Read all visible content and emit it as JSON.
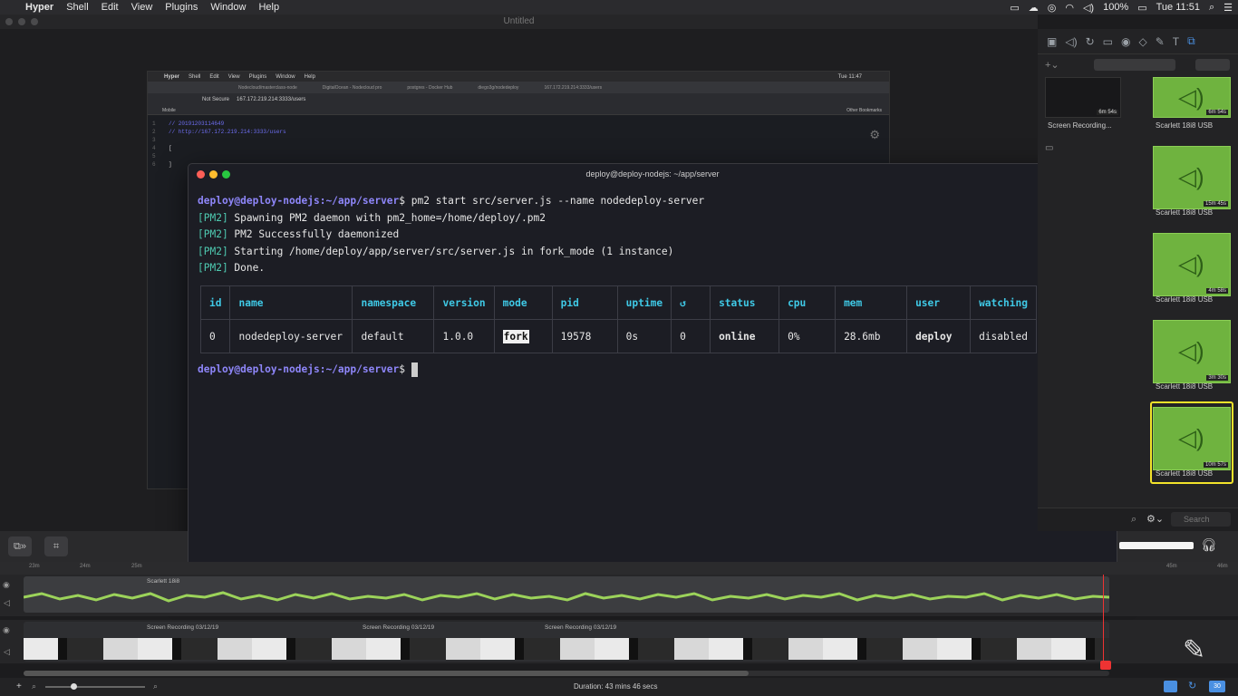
{
  "menubar": {
    "apple": "",
    "items": [
      "Hyper",
      "Shell",
      "Edit",
      "View",
      "Plugins",
      "Window",
      "Help"
    ],
    "battery": "100%",
    "clock": "Tue 11:51"
  },
  "window_title": "Untitled",
  "bg_screenshot": {
    "menu_items": [
      "Hyper",
      "Shell",
      "Edit",
      "View",
      "Plugins",
      "Window",
      "Help"
    ],
    "clock": "Tue 11:47",
    "tabs": [
      "Nodecloud/masterclass-node",
      "DigitalOcean - Nodecloud pro",
      "postgres - Docker Hub",
      "diego3g/nodedeploy",
      "167.172.219.214:3333/users"
    ],
    "url_security": "Not Secure",
    "url": "167.172.219.214:3333/users",
    "bookmark": "Mobile",
    "other_bookmarks": "Other Bookmarks",
    "code_lines": [
      {
        "n": "1",
        "text": "// 20191203114649"
      },
      {
        "n": "2",
        "text": "// http://167.172.219.214:3333/users"
      },
      {
        "n": "3",
        "text": ""
      },
      {
        "n": "4",
        "text": "["
      },
      {
        "n": "5",
        "text": ""
      },
      {
        "n": "6",
        "text": "]"
      }
    ]
  },
  "terminal": {
    "title": "deploy@deploy-nodejs: ~/app/server",
    "prompt": "deploy@deploy-nodejs:~/app/server",
    "command": "$ pm2 start src/server.js --name nodedeploy-server",
    "log": [
      {
        "tag": "[PM2]",
        "text": " Spawning PM2 daemon with pm2_home=/home/deploy/.pm2"
      },
      {
        "tag": "[PM2]",
        "text": " PM2 Successfully daemonized"
      },
      {
        "tag": "[PM2]",
        "text": " Starting /home/deploy/app/server/src/server.js in fork_mode (1 instance)"
      },
      {
        "tag": "[PM2]",
        "text": " Done."
      }
    ],
    "table": {
      "headers": [
        "id",
        "name",
        "namespace",
        "version",
        "mode",
        "pid",
        "uptime",
        "↺",
        "status",
        "cpu",
        "mem",
        "user",
        "watching"
      ],
      "row": {
        "id": "0",
        "name": "nodedeploy-server",
        "namespace": "default",
        "version": "1.0.0",
        "mode": "fork",
        "pid": "19578",
        "uptime": "0s",
        "restarts": "0",
        "status": "online",
        "cpu": "0%",
        "mem": "28.6mb",
        "user": "deploy",
        "watching": "disabled"
      }
    },
    "prompt2": "deploy@deploy-nodejs:~/app/server",
    "prompt2_suffix": "$ "
  },
  "right_panel": {
    "clips": [
      {
        "label": "Screen Recording...",
        "duration": "6m 54s",
        "type": "video"
      },
      {
        "label": "Scarlett 18i8 USB",
        "duration": "6m 54s",
        "type": "audio"
      },
      {
        "label": "Scarlett 18i8 USB",
        "duration": "15m 45s",
        "type": "audio"
      },
      {
        "label": "Scarlett 18i8 USB",
        "duration": "4m 58s",
        "type": "audio"
      },
      {
        "label": "Scarlett 18i8 USB",
        "duration": "3m 30s",
        "type": "audio"
      },
      {
        "label": "Scarlett 18i8 USB",
        "duration": "10m 57s",
        "type": "audio",
        "selected": true
      }
    ],
    "search_placeholder": "Search"
  },
  "timeline": {
    "ruler": [
      "23m",
      "24m",
      "25m",
      "45m",
      "46m"
    ],
    "audio_label": "Scarlett 18i8",
    "recordings": [
      "Screen Recording 03/12/19",
      "Screen Recording 03/12/19",
      "Screen Recording 03/12/19"
    ],
    "duration": "Duration: 43 mins 46 secs",
    "zoom_level": 0.1
  },
  "colors": {
    "prompt": "#8e86f9",
    "pm2_tag": "#4ec9b0",
    "table_header": "#3fc9e6",
    "status_online": "#4fd35a",
    "clip_green": "#6fb33f",
    "selected_border": "#f2e22a"
  }
}
